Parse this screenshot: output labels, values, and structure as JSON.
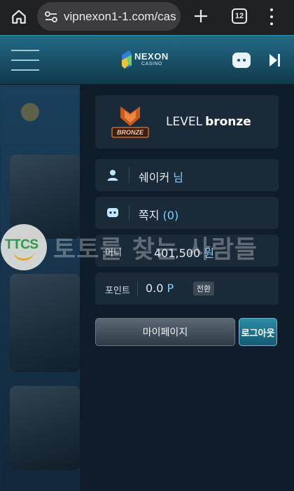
{
  "browser": {
    "url": "vipnexon1-1.com/cas",
    "tab_count": "12"
  },
  "header": {
    "logo_text": "NEXON",
    "logo_sub": "CASINO"
  },
  "panel": {
    "level_prefix": "LEVEL",
    "level_value": "bronze",
    "badge_text": "BRONZE",
    "user_name": "쉐이커",
    "user_suffix": "님",
    "messages_label": "쪽지",
    "messages_count": "(0)",
    "money_label": "머니",
    "money_value": "401,500",
    "money_unit": "원",
    "point_label": "포인트",
    "point_value": "0.0",
    "point_unit": "P",
    "convert_label": "전환",
    "mypage_label": "마이페이지",
    "logout_label": "로그아웃"
  },
  "watermark": {
    "logo_text": "TTCS",
    "text": "토토를 찾는 사람들"
  },
  "colors": {
    "header_top": "#236a86",
    "panel_bg": "#0f1c29",
    "card_bg": "#1b2a39",
    "accent": "#7fd0ff",
    "logout_bg": "#155a72"
  }
}
